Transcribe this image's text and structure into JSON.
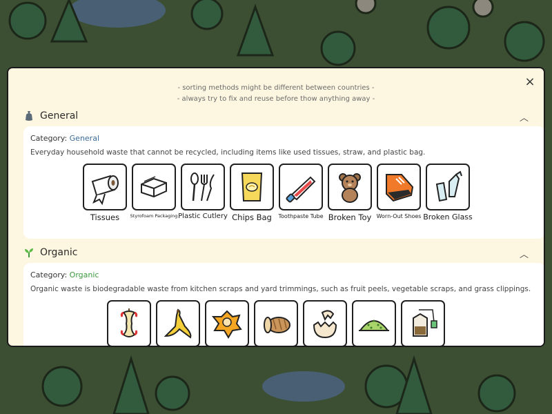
{
  "modal": {
    "close_icon": "×",
    "notes": [
      "- sorting methods might be different between countries -",
      "- always try to fix and reuse before thow anything away -"
    ]
  },
  "sections": [
    {
      "title": "General",
      "icon": "trash-bag-icon",
      "category_prefix": "Category:",
      "category_value": "General",
      "category_color": "#3a6b9a",
      "description": "Everyday household waste that cannot be recycled, including items like used tissues, straw, and plastic bag.",
      "items": [
        {
          "label": "Tissues",
          "icon": "tissue-roll-icon"
        },
        {
          "label": "Styrofoam Packaging",
          "icon": "styrofoam-box-icon"
        },
        {
          "label": "Plastic Cutlery",
          "icon": "cutlery-icon"
        },
        {
          "label": "Chips Bag",
          "icon": "chips-bag-icon"
        },
        {
          "label": "Toothpaste Tube",
          "icon": "toothpaste-icon"
        },
        {
          "label": "Broken Toy",
          "icon": "teddy-bear-icon"
        },
        {
          "label": "Worn-Out Shoes",
          "icon": "shoe-icon"
        },
        {
          "label": "Broken Glass",
          "icon": "broken-glass-icon"
        }
      ]
    },
    {
      "title": "Organic",
      "icon": "sprout-icon",
      "category_prefix": "Category:",
      "category_value": "Organic",
      "category_color": "#3c9a3c",
      "description": "Organic waste is biodegradable waste from kitchen scraps and yard trimmings, such as fruit peels, vegetable scraps, and grass clippings.",
      "items": [
        {
          "label": "",
          "icon": "apple-core-icon"
        },
        {
          "label": "",
          "icon": "banana-peel-icon"
        },
        {
          "label": "",
          "icon": "orange-peel-icon"
        },
        {
          "label": "",
          "icon": "bread-icon"
        },
        {
          "label": "",
          "icon": "eggshell-icon"
        },
        {
          "label": "",
          "icon": "grass-clippings-icon"
        },
        {
          "label": "",
          "icon": "tea-bag-icon"
        }
      ]
    }
  ]
}
